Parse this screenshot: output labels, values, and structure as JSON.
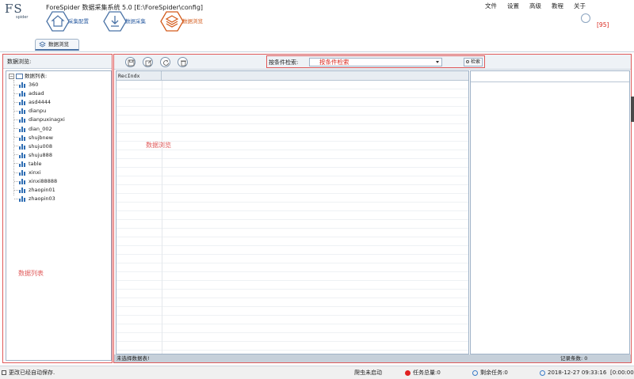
{
  "app": {
    "logo_text": "FS",
    "logo_sub": "spider",
    "title": "ForeSpider 数据采集系统  5.0  [E:\\ForeSpider\\config]"
  },
  "menu": [
    "文件",
    "设置",
    "高级",
    "教程",
    "关于"
  ],
  "nav": [
    {
      "label": "采集配置",
      "color": "#2e5fa3"
    },
    {
      "label": "数据采集",
      "color": "#2e5fa3"
    },
    {
      "label": "数据浏览",
      "color": "#d35a1a"
    }
  ],
  "notification_badge": "[95]",
  "tab": {
    "label": "数据浏览"
  },
  "left": {
    "header": "数据浏览:",
    "root_label": "数据列表:",
    "items": [
      "360",
      "adsad",
      "asd4444",
      "dianpu",
      "dianpuxinagxi",
      "dian_002",
      "shujbnew",
      "shuju008",
      "shuju888",
      "table",
      "xinxi",
      "xinxi88888",
      "zhaopin01",
      "zhaopin03"
    ],
    "annotation": "数据列表"
  },
  "right": {
    "toolbar_icons": [
      "save-icon",
      "edit-icon",
      "refresh-icon",
      "delete-icon"
    ],
    "search": {
      "label": "按条件检索:",
      "selected": "按条件检索",
      "button": "检索"
    },
    "grid": {
      "columns": [
        "RecIndx"
      ],
      "annotation": "数据浏览"
    },
    "status_left": "未选择数据表!",
    "status_right": "记录条数: 0"
  },
  "statusbar": {
    "message": "更改已经自动保存.",
    "crawler": "爬虫未启动",
    "tasks_total": "任务总量:0",
    "tasks_left": "剩余任务:0",
    "datetime": "2018-12-27  09:33:16",
    "elapsed": "[0:00:00"
  },
  "colors": {
    "accent_blue": "#2e5fa3",
    "accent_orange": "#d35a1a",
    "annotation_red": "#e05a5a"
  }
}
